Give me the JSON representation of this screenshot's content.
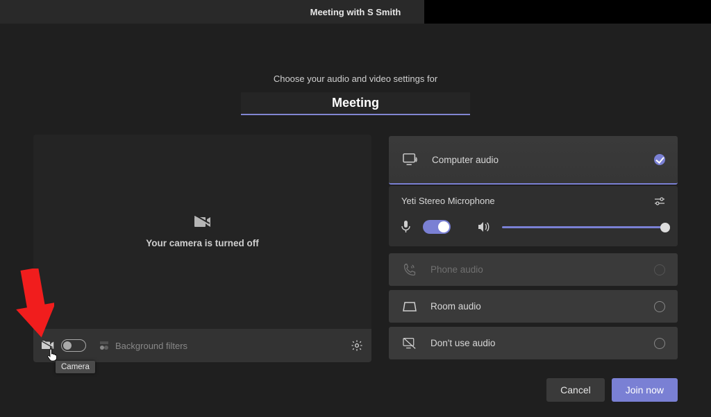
{
  "titlebar": {
    "title": "Meeting with S Smith"
  },
  "prompt": "Choose your audio and video settings for",
  "meeting_name": "Meeting",
  "video": {
    "off_text": "Your camera is turned off",
    "bg_filters_label": "Background filters",
    "tooltip": "Camera"
  },
  "audio": {
    "computer_label": "Computer audio",
    "device_name": "Yeti Stereo Microphone",
    "phone_label": "Phone audio",
    "room_label": "Room audio",
    "none_label": "Don't use audio"
  },
  "buttons": {
    "cancel": "Cancel",
    "join": "Join now"
  },
  "colors": {
    "accent": "#7a80d4",
    "annotation": "#f11d1d"
  }
}
